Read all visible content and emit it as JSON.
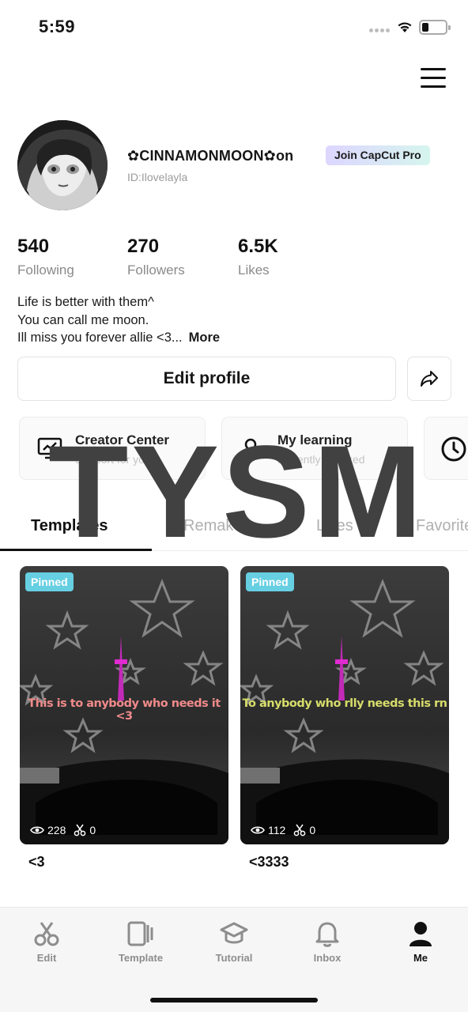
{
  "status_bar": {
    "time": "5:59"
  },
  "profile": {
    "username": "✿CINNAMONMOON✿on",
    "pro_badge": "Join CapCut Pro",
    "user_id": "ID:Ilovelayla",
    "stats": [
      {
        "value": "540",
        "label": "Following"
      },
      {
        "value": "270",
        "label": "Followers"
      },
      {
        "value": "6.5K",
        "label": "Likes"
      }
    ],
    "bio_lines": [
      "Life is better with them^",
      "You can call me moon.",
      "Ill miss you forever allie <3..."
    ],
    "bio_more": "More",
    "edit_profile": "Edit profile"
  },
  "cards": [
    {
      "title": "Creator Center",
      "subtitle": "Support for you",
      "icon": "monitor-chart-icon"
    },
    {
      "title": "My learning",
      "subtitle": "Recently checked",
      "icon": "learning-icon"
    },
    {
      "icon": "clock-icon"
    }
  ],
  "tabs": [
    "Templates",
    "Remakes",
    "Likes",
    "Favorites"
  ],
  "active_tab": "Templates",
  "overlay_text": "TYSM",
  "templates": [
    {
      "pinned_label": "Pinned",
      "caption": "This is to anybody who needs it <3",
      "caption_color": "#f08a8a",
      "views": "228",
      "uses": "0",
      "name": "<3"
    },
    {
      "pinned_label": "Pinned",
      "caption": "To anybody who rlly needs this rn",
      "caption_color": "#d6dc6a",
      "views": "112",
      "uses": "0",
      "name": "<3333"
    }
  ],
  "bottom_nav": [
    {
      "label": "Edit",
      "icon": "scissors-icon"
    },
    {
      "label": "Template",
      "icon": "template-icon"
    },
    {
      "label": "Tutorial",
      "icon": "graduation-cap-icon"
    },
    {
      "label": "Inbox",
      "icon": "bell-icon"
    },
    {
      "label": "Me",
      "icon": "person-icon",
      "active": true
    }
  ],
  "colors": {
    "pinned": "#66cfe2",
    "pro_gradient_start": "#ddd6ff",
    "pro_gradient_end": "#d6f5ee",
    "text_primary": "#111111",
    "text_muted": "#8a8a8a"
  }
}
